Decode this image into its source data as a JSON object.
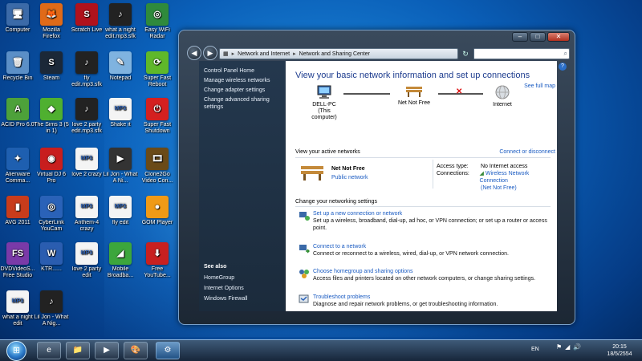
{
  "desktop": {
    "icons": [
      {
        "label": "Computer",
        "glyph": "🖥",
        "color": "#3b6aa8"
      },
      {
        "label": "Mozilla Firefox",
        "glyph": "🦊",
        "color": "#e06a18"
      },
      {
        "label": "Scratch Live",
        "glyph": "S",
        "color": "#b0121c"
      },
      {
        "label": "what a night edit.mp3.sfk",
        "glyph": "♪",
        "color": "#222222"
      },
      {
        "label": "Easy WiFi Radar",
        "glyph": "◎",
        "color": "#2f8a3c"
      },
      {
        "label": "Recycle Bin",
        "glyph": "🗑",
        "color": "#5b8fc7"
      },
      {
        "label": "Steam",
        "glyph": "S",
        "color": "#1b2838"
      },
      {
        "label": "fly edit.mp3.sfk",
        "glyph": "♪",
        "color": "#222222"
      },
      {
        "label": "Notepad",
        "glyph": "✎",
        "color": "#7fb3e0"
      },
      {
        "label": "Super Fast Reboot",
        "glyph": "⟳",
        "color": "#5fb82a"
      },
      {
        "label": "ACID Pro 6.0",
        "glyph": "A",
        "color": "#4da13a"
      },
      {
        "label": "The Sims 3 (5 in 1)",
        "glyph": "◆",
        "color": "#4fb030"
      },
      {
        "label": "love 2 party edit.mp3.sfk",
        "glyph": "♪",
        "color": "#222222"
      },
      {
        "label": "Shake it",
        "glyph": "MP3",
        "color": "#f4f4f4"
      },
      {
        "label": "Super Fast Shutdown",
        "glyph": "⏻",
        "color": "#d42020"
      },
      {
        "label": "Alienware Comma...",
        "glyph": "✦",
        "color": "#1e5fb0"
      },
      {
        "label": "Virtual DJ 6 Pro",
        "glyph": "◉",
        "color": "#c81e1e"
      },
      {
        "label": "love 2 crazy",
        "glyph": "MP3",
        "color": "#f4f4f4"
      },
      {
        "label": "Lil Jon - What A Ni...",
        "glyph": "▶",
        "color": "#333333"
      },
      {
        "label": "Clone2Go Video Con...",
        "glyph": "🎞",
        "color": "#6a4a18"
      },
      {
        "label": "AVG 2011",
        "glyph": "▮",
        "color": "#c83c1c"
      },
      {
        "label": "CyberLink YouCam",
        "glyph": "◎",
        "color": "#2a62b8"
      },
      {
        "label": "Anthem-4 crazy",
        "glyph": "MP3",
        "color": "#f4f4f4"
      },
      {
        "label": "fly edit",
        "glyph": "MP3",
        "color": "#f4f4f4"
      },
      {
        "label": "GOM Player",
        "glyph": "●",
        "color": "#f09a16"
      },
      {
        "label": "DVDVideoS... Free Studio",
        "glyph": "FS",
        "color": "#7a3aa8"
      },
      {
        "label": "KTR......",
        "glyph": "W",
        "color": "#2a5db0"
      },
      {
        "label": "love 2 party edit",
        "glyph": "MP3",
        "color": "#f4f4f4"
      },
      {
        "label": "Mobile Broadba...",
        "glyph": "◢",
        "color": "#3ca63c"
      },
      {
        "label": "Free YouTube...",
        "glyph": "⬇",
        "color": "#c82020"
      },
      {
        "label": "what a night edit",
        "glyph": "MP3",
        "color": "#f4f4f4"
      },
      {
        "label": "Lil Jon - What A Nig...",
        "glyph": "♪",
        "color": "#222222"
      }
    ]
  },
  "window": {
    "breadcrumb": [
      "Network and Internet",
      "Network and Sharing Center"
    ],
    "search_placeholder": "",
    "controls": {
      "minimize": "–",
      "maximize": "□",
      "close": "✕"
    },
    "nav_back": "◀",
    "nav_forward": "▶",
    "refresh": "↻",
    "help": "?"
  },
  "left_pane": {
    "home": "Control Panel Home",
    "links": [
      "Manage wireless networks",
      "Change adapter settings",
      "Change advanced sharing settings"
    ],
    "see_also_heading": "See also",
    "see_also": [
      "HomeGroup",
      "Internet Options",
      "Windows Firewall"
    ]
  },
  "main": {
    "title": "View your basic network information and set up connections",
    "see_full_map": "See full map",
    "map": {
      "computer_name": "DELL-PC",
      "computer_sub": "(This computer)",
      "network": "Net Not Free",
      "internet": "Internet"
    },
    "active_networks_heading": "View your active networks",
    "connect_disconnect": "Connect or disconnect",
    "active_network": {
      "name": "Net Not Free",
      "type": "Public network",
      "access_type_label": "Access type:",
      "access_type_value": "No Internet access",
      "connections_label": "Connections:",
      "connections_value": "Wireless Network Connection",
      "connections_sub": "(Net Not Free)"
    },
    "change_settings_heading": "Change your networking settings",
    "tasks": [
      {
        "title": "Set up a new connection or network",
        "desc": "Set up a wireless, broadband, dial-up, ad hoc, or VPN connection; or set up a router or access point."
      },
      {
        "title": "Connect to a network",
        "desc": "Connect or reconnect to a wireless, wired, dial-up, or VPN network connection."
      },
      {
        "title": "Choose homegroup and sharing options",
        "desc": "Access files and printers located on other network computers, or change sharing settings."
      },
      {
        "title": "Troubleshoot problems",
        "desc": "Diagnose and repair network problems, or get troubleshooting information."
      }
    ]
  },
  "taskbar": {
    "start": "⊞",
    "language": "EN",
    "time": "20:15",
    "date": "18/5/2554",
    "pinned": [
      {
        "name": "ie",
        "glyph": "e"
      },
      {
        "name": "explorer",
        "glyph": "📁"
      },
      {
        "name": "media-player",
        "glyph": "▶"
      },
      {
        "name": "paint",
        "glyph": "🎨"
      },
      {
        "name": "control-panel",
        "glyph": "⚙"
      }
    ]
  }
}
